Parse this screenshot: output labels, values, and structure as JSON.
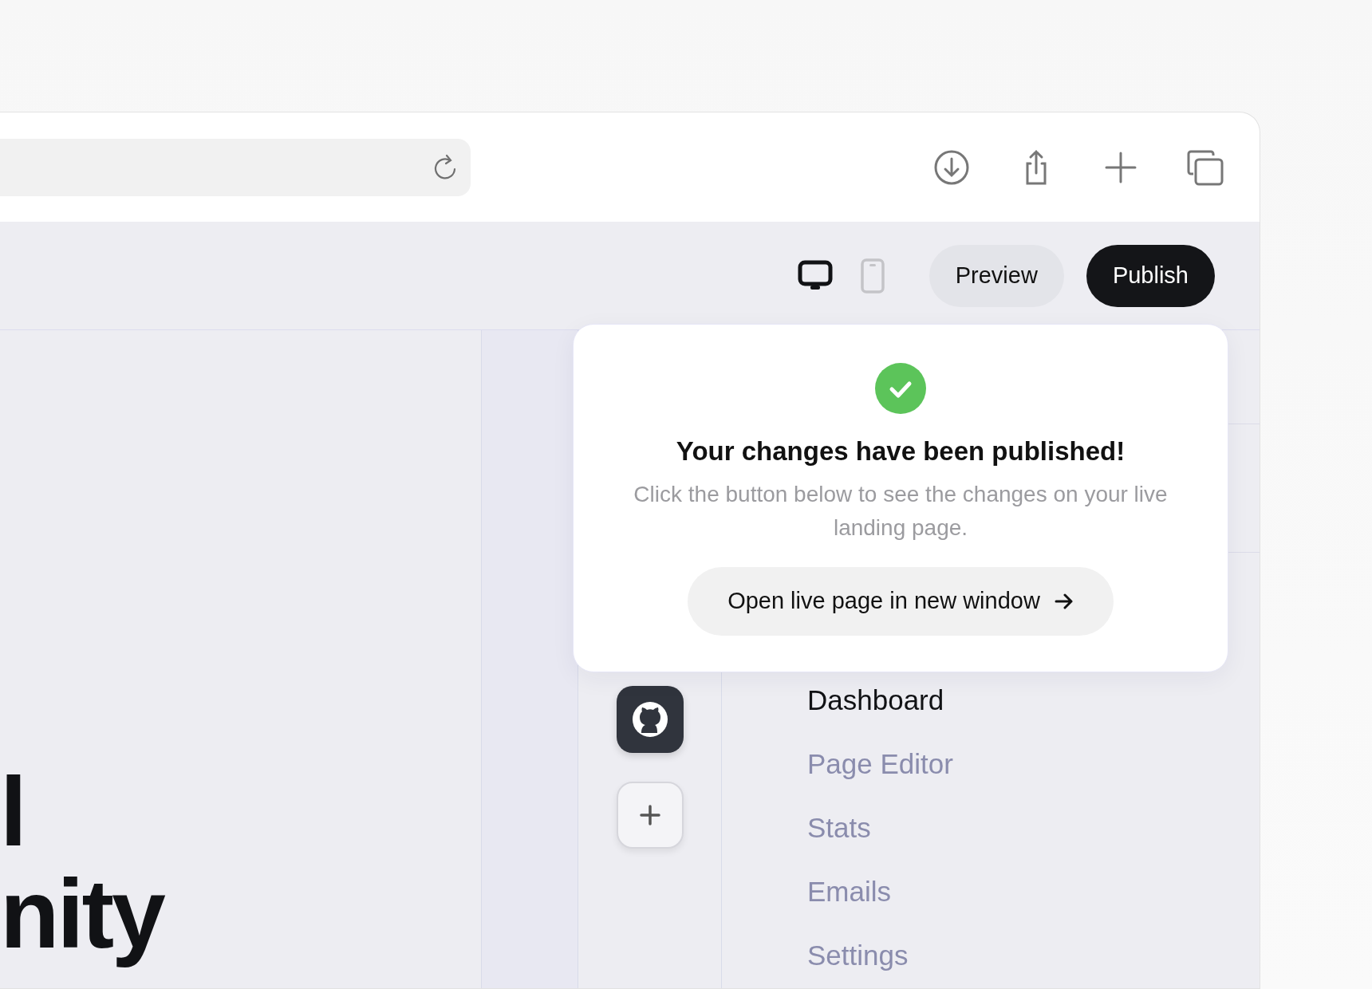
{
  "editor_toolbar": {
    "view_modes": [
      {
        "kind": "desktop",
        "selected": true
      },
      {
        "kind": "mobile",
        "selected": false
      }
    ],
    "buttons": [
      {
        "label": "Preview",
        "kind": "secondary"
      },
      {
        "label": "Publish",
        "kind": "primary"
      }
    ]
  },
  "canvas": {
    "heading_lines": [
      "l",
      "nity"
    ]
  },
  "sidebar": {
    "items": [
      {
        "label": "Dashboard",
        "selected": true
      },
      {
        "label": "Page Editor",
        "selected": false
      },
      {
        "label": "Stats",
        "selected": false
      },
      {
        "label": "Emails",
        "selected": false
      },
      {
        "label": "Settings",
        "selected": false
      }
    ]
  },
  "popup": {
    "title": "Your changes have been published!",
    "message": "Click the button below to see the changes on your live landing page.",
    "button": "Open live page in new window"
  }
}
